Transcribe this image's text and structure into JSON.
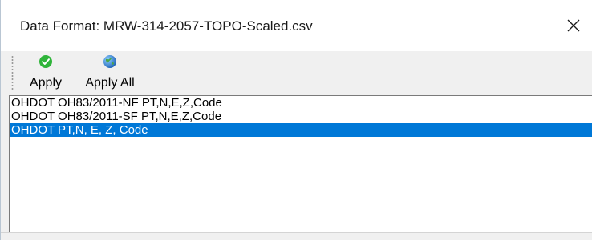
{
  "window": {
    "title": "Data Format: MRW-314-2057-TOPO-Scaled.csv",
    "close_icon": "close-x-icon"
  },
  "toolbar": {
    "apply": {
      "label": "Apply",
      "icon": "green-check-icon",
      "color": "#2fb43a"
    },
    "apply_all": {
      "label": "Apply All",
      "icon": "globe-icon",
      "color": "#2f7fd0"
    }
  },
  "formats": {
    "items": [
      {
        "label": "OHDOT OH83/2011-NF PT,N,E,Z,Code",
        "selected": false
      },
      {
        "label": "OHDOT OH83/2011-SF PT,N,E,Z,Code",
        "selected": false
      },
      {
        "label": "OHDOT PT,N, E, Z, Code",
        "selected": true
      }
    ],
    "selection_color": "#0078d7"
  }
}
